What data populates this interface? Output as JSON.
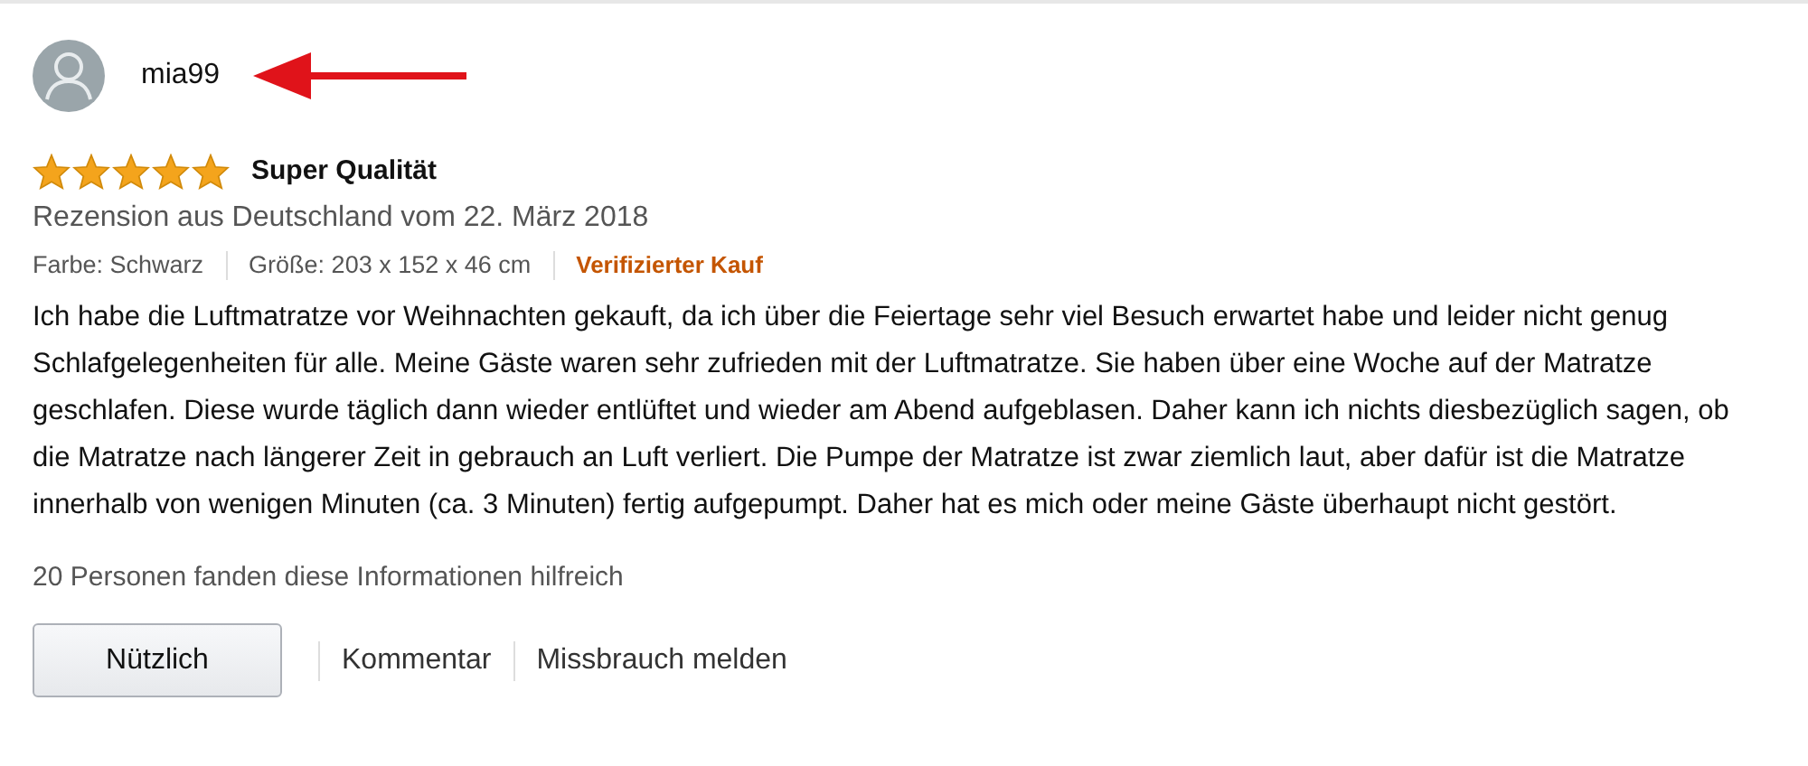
{
  "review": {
    "author": "mia99",
    "stars": 5,
    "title": "Super Qualität",
    "date_line": "Rezension aus Deutschland vom 22. März 2018",
    "meta": [
      {
        "kind": "attr",
        "text": "Farbe: Schwarz"
      },
      {
        "kind": "attr",
        "text": "Größe: 203 x 152 x 46 cm"
      },
      {
        "kind": "badge",
        "text": "Verifizierter Kauf"
      }
    ],
    "body": "Ich habe die Luftmatratze vor Weihnachten gekauft, da ich über die Feiertage sehr viel Besuch erwartet habe und leider nicht genug Schlafgelegenheiten für alle. Meine Gäste waren sehr zufrieden mit der Luftmatratze. Sie haben über eine Woche auf der Matratze geschlafen. Diese wurde täglich dann wieder entlüftet und wieder am Abend aufgeblasen. Daher kann ich nichts diesbezüglich sagen, ob die Matratze nach längerer Zeit in gebrauch an Luft verliert. Die Pumpe der Matratze ist zwar ziemlich laut, aber dafür ist die Matratze innerhalb von wenigen Minuten (ca. 3 Minuten) fertig aufgepumpt. Daher hat es mich oder meine Gäste überhaupt nicht gestört.",
    "helpful": "20 Personen fanden diese Informationen hilfreich",
    "button": "Nützlich",
    "links": [
      "Kommentar",
      "Missbrauch melden"
    ]
  }
}
